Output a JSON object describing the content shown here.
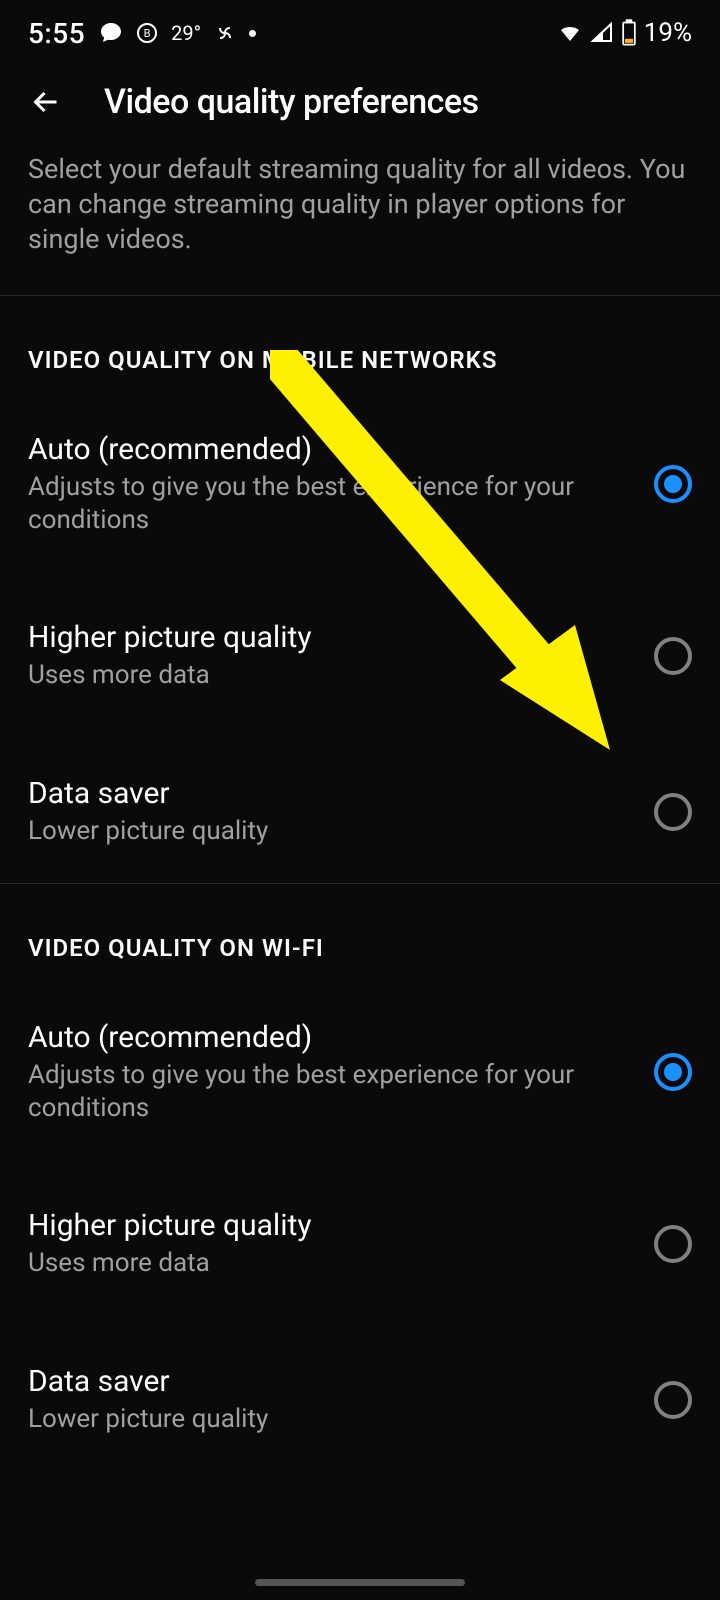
{
  "status": {
    "time": "5:55",
    "temp": "29°",
    "battery": "19%"
  },
  "header": {
    "title": "Video quality preferences"
  },
  "description": "Select your default streaming quality for all videos. You can change streaming quality in player options for single videos.",
  "sections": {
    "mobile": {
      "header": "VIDEO QUALITY ON MOBILE NETWORKS",
      "options": [
        {
          "title": "Auto (recommended)",
          "subtitle": "Adjusts to give you the best experience for your conditions",
          "selected": true
        },
        {
          "title": "Higher picture quality",
          "subtitle": "Uses more data",
          "selected": false
        },
        {
          "title": "Data saver",
          "subtitle": "Lower picture quality",
          "selected": false
        }
      ]
    },
    "wifi": {
      "header": "VIDEO QUALITY ON WI-FI",
      "options": [
        {
          "title": "Auto (recommended)",
          "subtitle": "Adjusts to give you the best experience for your conditions",
          "selected": true
        },
        {
          "title": "Higher picture quality",
          "subtitle": "Uses more data",
          "selected": false
        },
        {
          "title": "Data saver",
          "subtitle": "Lower picture quality",
          "selected": false
        }
      ]
    }
  }
}
